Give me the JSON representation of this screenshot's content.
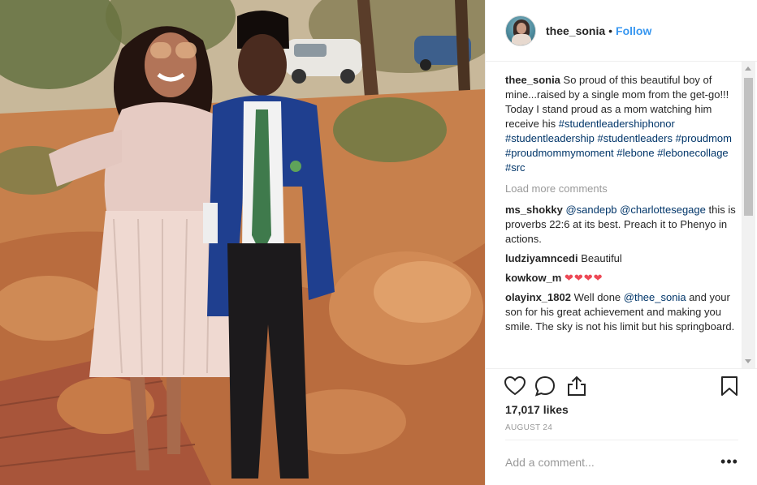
{
  "post": {
    "username": "thee_sonia",
    "separator": "•",
    "follow_label": "Follow"
  },
  "caption": {
    "username": "thee_sonia",
    "text": " So proud of this beautiful boy of mine...raised by a single mom from the get-go!!! Today I stand proud as a mom watching him receive his ",
    "hashtags": [
      "#studentleadershiphonor",
      "#studentleadership",
      "#studentleaders",
      "#proudmom",
      "#proudmommymoment",
      "#lebone",
      "#lebonecollage",
      "#src"
    ]
  },
  "load_more_label": "Load more comments",
  "comments": [
    {
      "username": "ms_shokky",
      "mention_1": "@sandepb",
      "mention_2": "@charlottesegage",
      "text": "this is proverbs 22:6 at its best. Preach it to Phenyo in actions."
    },
    {
      "username": "ludziyamncedi",
      "text": "Beautiful"
    },
    {
      "username": "kowkow_m",
      "text": "❤❤❤❤"
    },
    {
      "username": "olayinx_1802",
      "text_before": "Well done ",
      "mention": "@thee_sonia",
      "text_after": " and your son for his great achievement and making you smile. The sky is not his limit but his springboard."
    }
  ],
  "actions": {
    "like_icon": "heart-icon",
    "comment_icon": "comment-icon",
    "share_icon": "share-icon",
    "save_icon": "bookmark-icon"
  },
  "likes": "17,017 likes",
  "date": "AUGUST 24",
  "add_comment": {
    "placeholder": "Add a comment..."
  },
  "more_label": "•••",
  "colors": {
    "link_blue": "#3897f0",
    "hashtag": "#003569",
    "muted": "#999999",
    "heart_red": "#ed4956",
    "text": "#262626"
  }
}
